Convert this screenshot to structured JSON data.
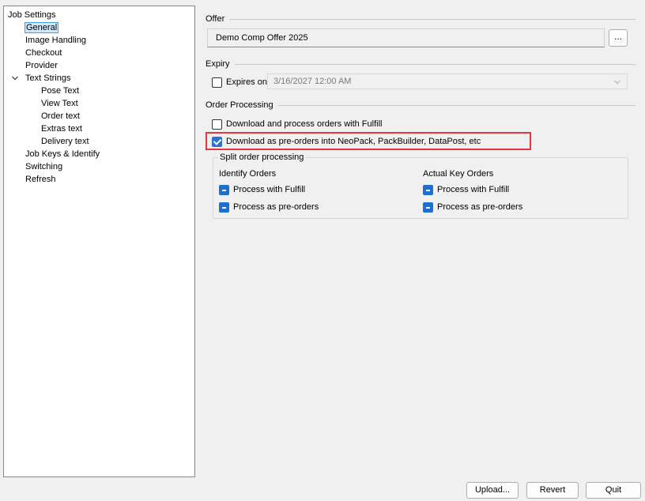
{
  "tree": {
    "items": [
      {
        "label": "Job Settings",
        "level": 0,
        "selected": false
      },
      {
        "label": "General",
        "level": 1,
        "selected": true
      },
      {
        "label": "Image Handling",
        "level": 1,
        "selected": false
      },
      {
        "label": "Checkout",
        "level": 1,
        "selected": false
      },
      {
        "label": "Provider",
        "level": 1,
        "selected": false
      },
      {
        "label": "Text Strings",
        "level": 1,
        "selected": false,
        "expanded": true
      },
      {
        "label": "Pose Text",
        "level": 2,
        "selected": false
      },
      {
        "label": "View Text",
        "level": 2,
        "selected": false
      },
      {
        "label": "Order text",
        "level": 2,
        "selected": false
      },
      {
        "label": "Extras text",
        "level": 2,
        "selected": false
      },
      {
        "label": "Delivery text",
        "level": 2,
        "selected": false
      },
      {
        "label": "Job Keys & Identify",
        "level": 1,
        "selected": false
      },
      {
        "label": "Switching",
        "level": 1,
        "selected": false
      },
      {
        "label": "Refresh",
        "level": 1,
        "selected": false
      }
    ]
  },
  "offer": {
    "group_title": "Offer",
    "value": "Demo Comp Offer 2025",
    "browse_label": "..."
  },
  "expiry": {
    "group_title": "Expiry",
    "checkbox_label": "Expires on",
    "checked": false,
    "date_value": "3/16/2027 12:00 AM"
  },
  "order_processing": {
    "group_title": "Order Processing",
    "fulfill_label": "Download and process orders with Fulfill",
    "fulfill_checked": false,
    "preorder_label": "Download as pre-orders into NeoPack, PackBuilder, DataPost, etc",
    "preorder_checked": true
  },
  "split": {
    "title": "Split order processing",
    "identify_header": "Identify Orders",
    "identify_fulfill": "Process with Fulfill",
    "identify_preorders": "Process as pre-orders",
    "actual_header": "Actual Key Orders",
    "actual_fulfill": "Process with Fulfill",
    "actual_preorders": "Process as pre-orders"
  },
  "buttons": {
    "upload": "Upload...",
    "revert": "Revert",
    "quit": "Quit"
  },
  "colors": {
    "accent": "#1f6fd1",
    "highlight": "#e8353f",
    "selection": "#cce8ff"
  }
}
